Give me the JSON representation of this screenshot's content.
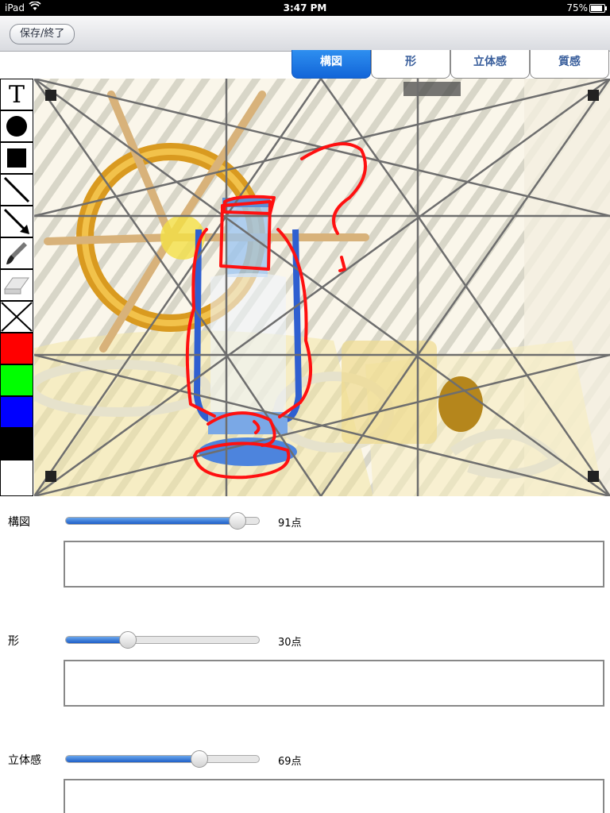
{
  "status_bar": {
    "carrier": "iPad",
    "time": "3:47 PM",
    "battery": "75%"
  },
  "toolbar": {
    "save_label": "保存/終了"
  },
  "tabs": [
    {
      "label": "構図",
      "active": true
    },
    {
      "label": "形",
      "active": false
    },
    {
      "label": "立体感",
      "active": false
    },
    {
      "label": "質感",
      "active": false
    }
  ],
  "tools": [
    {
      "name": "text-tool",
      "icon": "T"
    },
    {
      "name": "circle-tool",
      "icon": "filled-circle"
    },
    {
      "name": "rectangle-tool",
      "icon": "filled-square"
    },
    {
      "name": "line-tool",
      "icon": "diagonal-line"
    },
    {
      "name": "arrow-tool",
      "icon": "diagonal-arrow"
    },
    {
      "name": "pen-tool",
      "icon": "brush"
    },
    {
      "name": "eraser-tool",
      "icon": "eraser"
    },
    {
      "name": "clear-tool",
      "icon": "x-cross"
    }
  ],
  "colors": [
    "#ff0000",
    "#00ff00",
    "#0000ff",
    "#000000",
    "#ffffff"
  ],
  "criteria": [
    {
      "label": "構図",
      "score": 91,
      "score_text": "91点",
      "comment": ""
    },
    {
      "label": "形",
      "score": 30,
      "score_text": "30点",
      "comment": ""
    },
    {
      "label": "立体感",
      "score": 69,
      "score_text": "69点",
      "comment": ""
    }
  ]
}
